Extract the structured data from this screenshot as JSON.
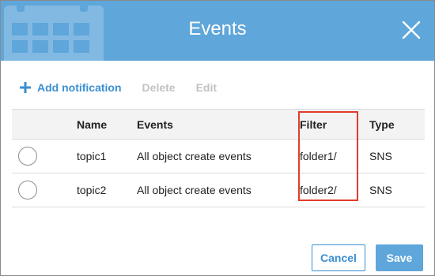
{
  "dialog": {
    "title": "Events",
    "close_icon": "close-icon"
  },
  "toolbar": {
    "add_label": "Add notification",
    "delete_label": "Delete",
    "edit_label": "Edit"
  },
  "table": {
    "headers": {
      "name": "Name",
      "events": "Events",
      "filter": "Filter",
      "type": "Type"
    },
    "rows": [
      {
        "name": "topic1",
        "events": "All object create events",
        "filter": "folder1/",
        "type": "SNS"
      },
      {
        "name": "topic2",
        "events": "All object create events",
        "filter": "folder2/",
        "type": "SNS"
      }
    ]
  },
  "footer": {
    "cancel_label": "Cancel",
    "save_label": "Save"
  },
  "colors": {
    "header_bg": "#5fa6da",
    "link": "#3a8fd2",
    "highlight": "#e23b2b"
  }
}
